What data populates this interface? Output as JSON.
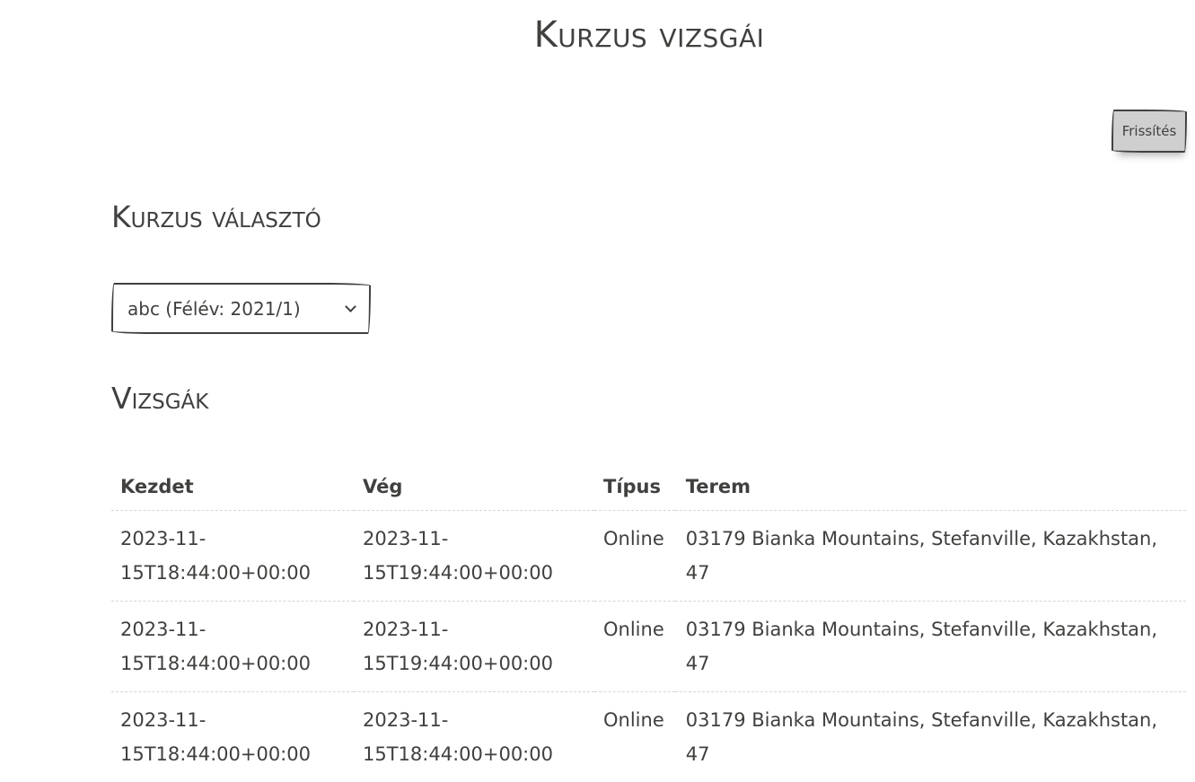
{
  "header": {
    "title": "Kurzus vizsgái",
    "refresh_label": "Frissítés"
  },
  "course_selector": {
    "heading": "Kurzus választó",
    "selected": "abc (Félév: 2021/1)"
  },
  "exams": {
    "heading": "Vizsgák",
    "columns": [
      "Kezdet",
      "Vég",
      "Típus",
      "Terem"
    ],
    "rows": [
      {
        "start": "2023-11-15T18:44:00+00:00",
        "end": "2023-11-15T19:44:00+00:00",
        "type": "Online",
        "room": "03179 Bianka Mountains, Stefanville, Kazakhstan, 47"
      },
      {
        "start": "2023-11-15T18:44:00+00:00",
        "end": "2023-11-15T19:44:00+00:00",
        "type": "Online",
        "room": "03179 Bianka Mountains, Stefanville, Kazakhstan, 47"
      },
      {
        "start": "2023-11-15T18:44:00+00:00",
        "end": "2023-11-15T18:44:00+00:00",
        "type": "Online",
        "room": "03179 Bianka Mountains, Stefanville, Kazakhstan, 47"
      }
    ]
  }
}
